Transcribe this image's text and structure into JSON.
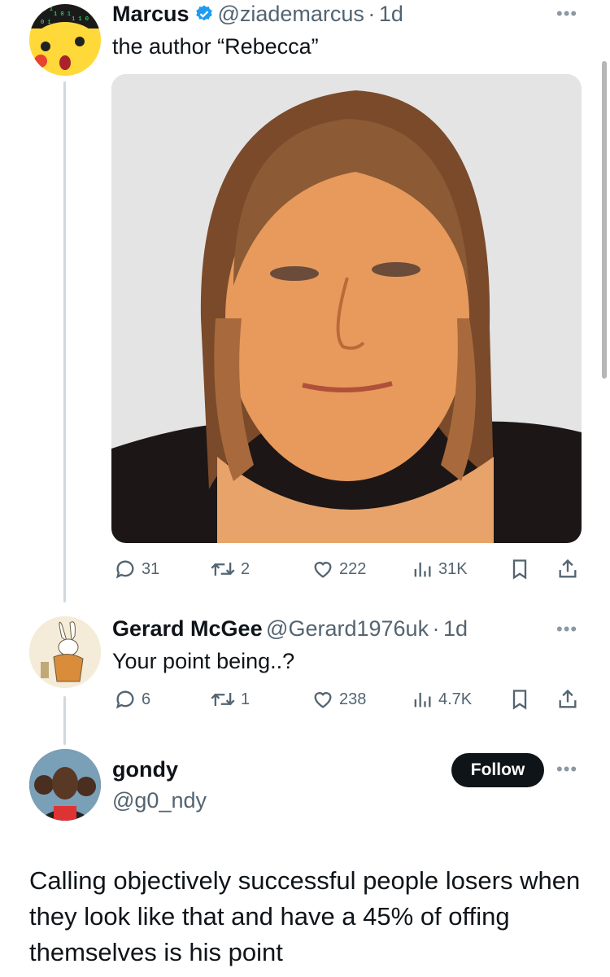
{
  "tweet1": {
    "name": "Marcus",
    "handle": "@ziademarcus",
    "dot": "·",
    "time": "1d",
    "text": "the author “Rebecca”",
    "stats": {
      "replies": "31",
      "retweets": "2",
      "likes": "222",
      "views": "31K"
    }
  },
  "tweet2": {
    "name": "Gerard McGee",
    "handle": "@Gerard1976uk",
    "dot": "·",
    "time": "1d",
    "text": "Your point being..?",
    "stats": {
      "replies": "6",
      "retweets": "1",
      "likes": "238",
      "views": "4.7K"
    }
  },
  "tweet3": {
    "name": "gondy",
    "handle": "@g0_ndy",
    "follow_label": "Follow",
    "text": "Calling objectively successful people losers when they look like that and have a 45% of offing themselves is his point"
  },
  "colors": {
    "verified": "#1d9bf0",
    "muted": "#536471",
    "line": "#cfd9de"
  },
  "icons": [
    "verified-badge-icon",
    "more-icon",
    "reply-icon",
    "retweet-icon",
    "like-icon",
    "views-icon",
    "bookmark-icon",
    "share-icon"
  ]
}
